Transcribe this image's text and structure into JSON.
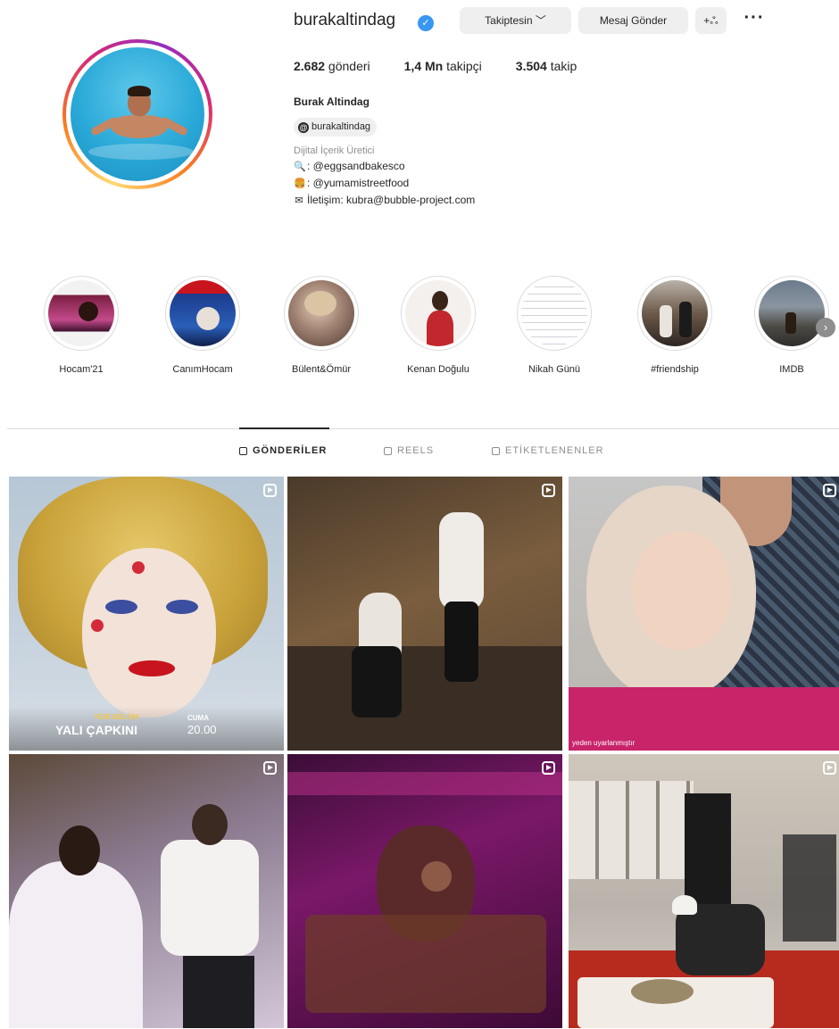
{
  "profile": {
    "username": "burakaltindag",
    "verified_mark": "✓",
    "follow_button": "Takiptesin ﹀",
    "message_button": "Mesaj Gönder",
    "add_user_button": "+ஃ",
    "more_button": "···",
    "stats": {
      "posts_count": "2.682",
      "posts_label": " gönderi",
      "followers_count": "1,4 Mn",
      "followers_label": " takipçi",
      "following_count": "3.504",
      "following_label": " takip"
    },
    "full_name": "Burak Altindag",
    "threads_handle": "burakaltindag",
    "threads_icon_glyph": "@",
    "category": "Dijital İçerik Üretici",
    "bio": [
      {
        "emoji": "🔍",
        "text": ": @eggsandbakesco"
      },
      {
        "emoji": "🍔",
        "text": ": @yumamistreetfood"
      },
      {
        "emoji": "✉",
        "text": "İletişim: kubra@bubble-project.com"
      }
    ]
  },
  "highlights": [
    {
      "label": "Hocam'21"
    },
    {
      "label": "CanımHocam"
    },
    {
      "label": "Bülent&Ömür"
    },
    {
      "label": "Kenan Doğulu"
    },
    {
      "label": "Nikah Günü"
    },
    {
      "label": "#friendship"
    },
    {
      "label": "IMDB"
    }
  ],
  "highlights_next": "›",
  "tabs": [
    {
      "label": "GÖNDERİLER",
      "active": true
    },
    {
      "label": "REELS",
      "active": false
    },
    {
      "label": "ETİKETLENENLER",
      "active": false
    }
  ],
  "posts": [
    {
      "type": "reel",
      "overlay": {
        "small": "YENİ BÖLÜM",
        "title": "YALI ÇAPKINI",
        "day": "CUMA",
        "time": "20.00"
      }
    },
    {
      "type": "reel"
    },
    {
      "type": "reel",
      "overlay": {
        "caption": "yeden uyarlanmıştır"
      }
    },
    {
      "type": "reel"
    },
    {
      "type": "reel"
    },
    {
      "type": "reel"
    }
  ],
  "icons": {
    "reel": "reel-icon",
    "grid": "grid-icon",
    "reels_tab": "reels-icon",
    "tagged": "tagged-icon"
  }
}
